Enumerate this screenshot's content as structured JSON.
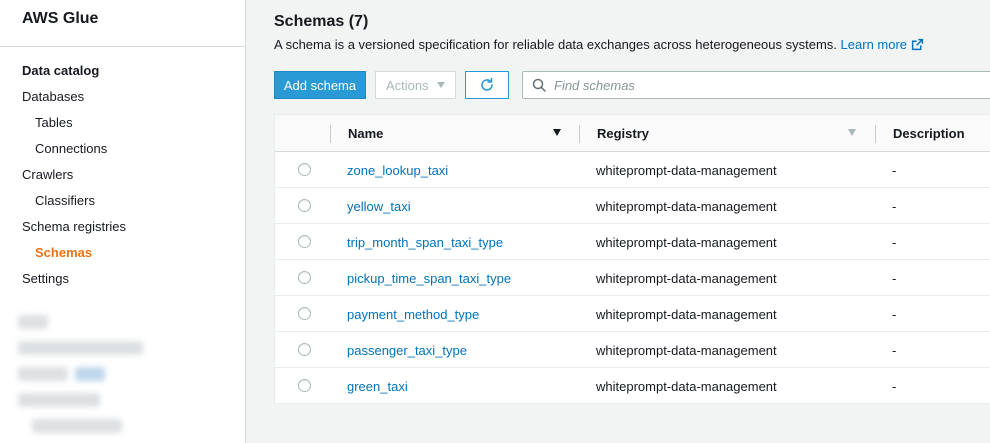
{
  "sidebar": {
    "title": "AWS Glue",
    "items": [
      {
        "label": "Data catalog"
      },
      {
        "label": "Databases"
      },
      {
        "label": "Tables"
      },
      {
        "label": "Connections"
      },
      {
        "label": "Crawlers"
      },
      {
        "label": "Classifiers"
      },
      {
        "label": "Schema registries"
      },
      {
        "label": "Schemas"
      },
      {
        "label": "Settings"
      }
    ],
    "active_item": "Schemas"
  },
  "main": {
    "title": "Schemas (7)",
    "description": "A schema is a versioned specification for reliable data exchanges across heterogeneous systems.",
    "learn_more": "Learn more",
    "toolbar": {
      "add_label": "Add schema",
      "actions_label": "Actions",
      "search_placeholder": "Find schemas"
    },
    "table": {
      "columns": [
        "Name",
        "Registry",
        "Description"
      ],
      "rows": [
        {
          "name": "zone_lookup_taxi",
          "registry": "whiteprompt-data-management",
          "description": "-"
        },
        {
          "name": "yellow_taxi",
          "registry": "whiteprompt-data-management",
          "description": "-"
        },
        {
          "name": "trip_month_span_taxi_type",
          "registry": "whiteprompt-data-management",
          "description": "-"
        },
        {
          "name": "pickup_time_span_taxi_type",
          "registry": "whiteprompt-data-management",
          "description": "-"
        },
        {
          "name": "payment_method_type",
          "registry": "whiteprompt-data-management",
          "description": "-"
        },
        {
          "name": "passenger_taxi_type",
          "registry": "whiteprompt-data-management",
          "description": "-"
        },
        {
          "name": "green_taxi",
          "registry": "whiteprompt-data-management",
          "description": "-"
        }
      ]
    }
  },
  "colors": {
    "accent": "#2a9ad6",
    "link": "#0073bb",
    "active_nav": "#ec7211"
  }
}
